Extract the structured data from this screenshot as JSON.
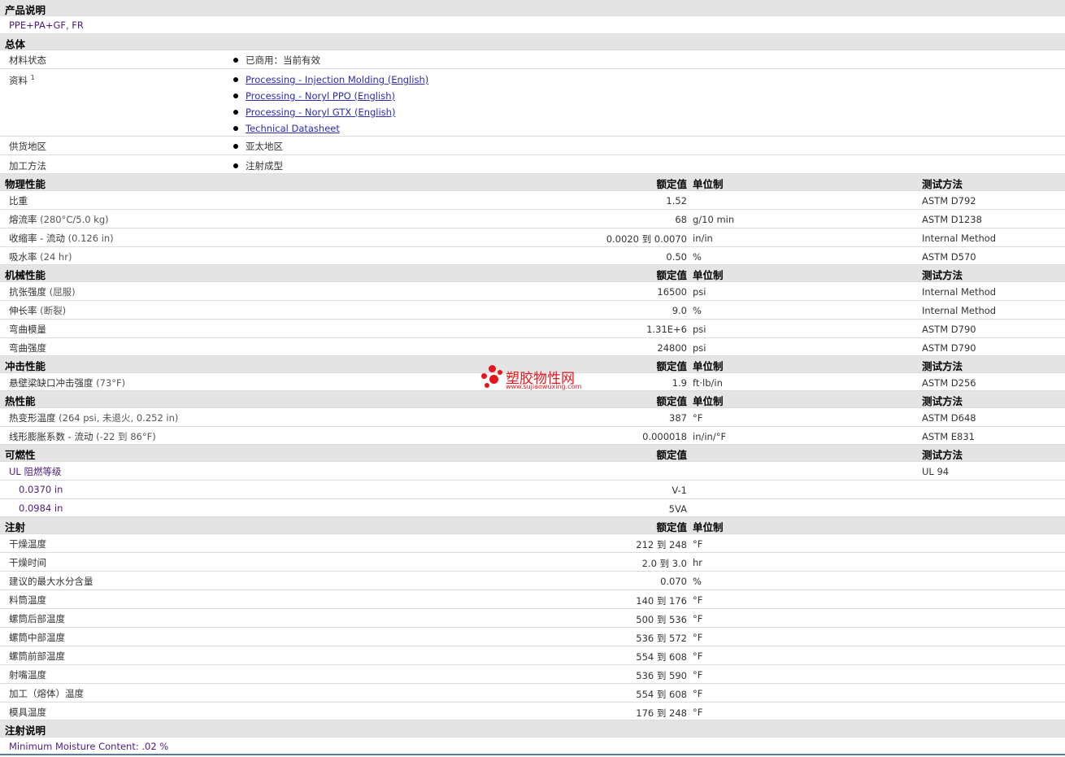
{
  "product": {
    "header": "产品说明",
    "desc": "PPE+PA+GF, FR"
  },
  "general": {
    "header": "总体",
    "status_label": "材料状态",
    "status_value": "已商用：当前有效",
    "docs_label": "资料",
    "docs_sup": "1",
    "docs": [
      "Processing - Injection Molding (English)",
      "Processing - Noryl PPO (English)",
      "Processing - Noryl GTX (English)",
      "Technical Datasheet"
    ],
    "region_label": "供货地区",
    "region_value": "亚太地区",
    "method_label": "加工方法",
    "method_value": "注射成型"
  },
  "col": {
    "value": "额定值",
    "unit": "单位制",
    "method": "测试方法"
  },
  "physical": {
    "header": "物理性能",
    "rows": [
      {
        "label": "比重",
        "cond": "",
        "value": "1.52",
        "unit": "",
        "method": "ASTM D792"
      },
      {
        "label": "熔流率",
        "cond": "(280°C/5.0 kg)",
        "value": "68",
        "unit": "g/10 min",
        "method": "ASTM D1238"
      },
      {
        "label": "收缩率 - 流动",
        "cond": "(0.126 in)",
        "value": "0.0020 到  0.0070",
        "unit": "in/in",
        "method": "Internal Method"
      },
      {
        "label": "吸水率",
        "cond": "(24 hr)",
        "value": "0.50",
        "unit": "%",
        "method": "ASTM D570"
      }
    ]
  },
  "mechanical": {
    "header": "机械性能",
    "rows": [
      {
        "label": "抗张强度",
        "cond": "(屈服)",
        "value": "16500",
        "unit": "psi",
        "method": "Internal Method"
      },
      {
        "label": "伸长率",
        "cond": "(断裂)",
        "value": "9.0",
        "unit": "%",
        "method": "Internal Method"
      },
      {
        "label": "弯曲模量",
        "cond": "",
        "value": "1.31E+6",
        "unit": "psi",
        "method": "ASTM D790"
      },
      {
        "label": "弯曲强度",
        "cond": "",
        "value": "24800",
        "unit": "psi",
        "method": "ASTM D790"
      }
    ]
  },
  "impact": {
    "header": "冲击性能",
    "rows": [
      {
        "label": "悬壁梁缺口冲击强度",
        "cond": "(73°F)",
        "value": "1.9",
        "unit": "ft·lb/in",
        "method": "ASTM D256"
      }
    ]
  },
  "thermal": {
    "header": "热性能",
    "rows": [
      {
        "label": "热变形温度",
        "cond": "(264 psi, 未退火, 0.252 in)",
        "value": "387",
        "unit": "°F",
        "method": "ASTM D648"
      },
      {
        "label": "线形膨胀系数 - 流动",
        "cond": "(-22 到  86°F)",
        "value": "0.000018",
        "unit": "in/in/°F",
        "method": "ASTM E831"
      }
    ]
  },
  "flammability": {
    "header": "可燃性",
    "ul_label": "UL 阻燃等级",
    "ul_method": "UL 94",
    "rows": [
      {
        "label": "0.0370 in",
        "value": "V-1"
      },
      {
        "label": "0.0984 in",
        "value": "5VA"
      }
    ]
  },
  "injection": {
    "header": "注射",
    "rows": [
      {
        "label": "干燥温度",
        "value": "212 到  248",
        "unit": "°F"
      },
      {
        "label": "干燥时间",
        "value": "2.0 到  3.0",
        "unit": "hr"
      },
      {
        "label": "建议的最大水分含量",
        "value": "0.070",
        "unit": "%"
      },
      {
        "label": "料筒温度",
        "value": "140 到  176",
        "unit": "°F"
      },
      {
        "label": "螺筒后部温度",
        "value": "500 到  536",
        "unit": "°F"
      },
      {
        "label": "螺筒中部温度",
        "value": "536 到  572",
        "unit": "°F"
      },
      {
        "label": "螺筒前部温度",
        "value": "554 到  608",
        "unit": "°F"
      },
      {
        "label": "射嘴温度",
        "value": "536 到  590",
        "unit": "°F"
      },
      {
        "label": "加工（熔体）温度",
        "value": "554 到  608",
        "unit": "°F"
      },
      {
        "label": "模具温度",
        "value": "176 到  248",
        "unit": "°F"
      }
    ]
  },
  "injection_notes": {
    "header": "注射说明",
    "text": "Minimum Moisture Content: .02 %"
  },
  "watermark": {
    "brand": "塑胶物性网",
    "site": "www.sujiaowuxing.com",
    "color": "#e8141c"
  }
}
